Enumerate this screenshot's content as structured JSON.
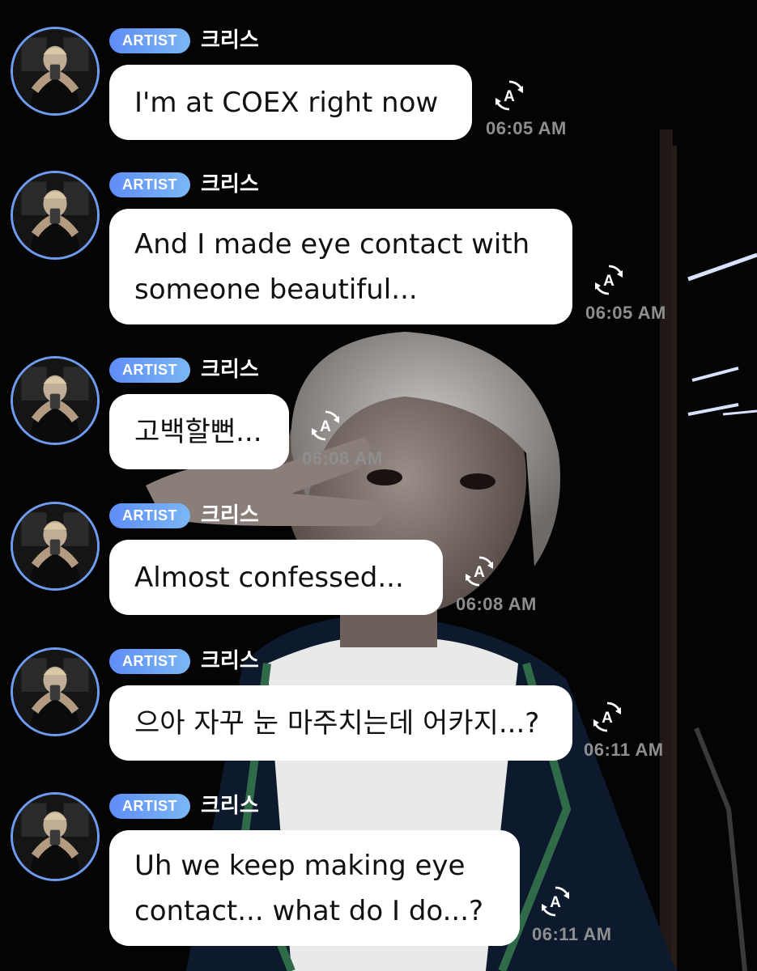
{
  "author_badge": "ARTIST",
  "messages": [
    {
      "author": "크리스",
      "text": "I'm at COEX right now",
      "time": "06:05 AM"
    },
    {
      "author": "크리스",
      "text": "And I made eye contact with someone beautiful...",
      "time": "06:05 AM"
    },
    {
      "author": "크리스",
      "text": "고백할뻔...",
      "time": "06:08 AM"
    },
    {
      "author": "크리스",
      "text": "Almost confessed...",
      "time": "06:08 AM"
    },
    {
      "author": "크리스",
      "text": "으아 자꾸 눈 마주치는데 어카지...?",
      "time": "06:11 AM"
    },
    {
      "author": "크리스",
      "text": "Uh we keep making eye contact... what do I do...?",
      "time": "06:11 AM"
    }
  ],
  "icons": {
    "avatar": "avatar-photo",
    "translate": "translate-icon"
  },
  "colors": {
    "badge": "#5e8df6",
    "avatar_ring": "#6f9bf0",
    "bubble": "#ffffff",
    "timestamp": "#8e8e8e"
  }
}
